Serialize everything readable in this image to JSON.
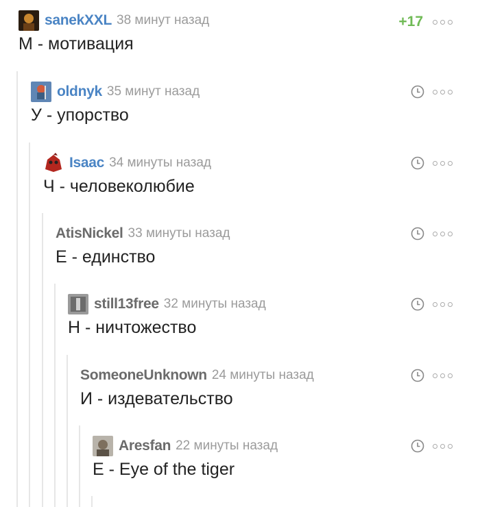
{
  "comments": [
    {
      "author": "sanekXXL",
      "author_color": "#4a84c4",
      "time": "38 минут назад",
      "text": "М - мотивация",
      "rating": "+17",
      "avatar": "dark-avatar"
    },
    {
      "author": "oldnyk",
      "author_color": "#4a84c4",
      "time": "35 минут назад",
      "text": "У - упорство",
      "avatar": "knight-avatar"
    },
    {
      "author": "Isaac",
      "author_color": "#4a84c4",
      "time": "34 минуты назад",
      "text": "Ч - человеколюбие",
      "avatar": "red-creature-avatar"
    },
    {
      "author": "AtisNickel",
      "author_color": "#6b6b6b",
      "time": "33 минуты назад",
      "text": "Е - единство"
    },
    {
      "author": "still13free",
      "author_color": "#6b6b6b",
      "time": "32 минуты назад",
      "text": "Н - ничтожество",
      "avatar": "gray-avatar"
    },
    {
      "author": "SomeoneUnknown",
      "author_color": "#6b6b6b",
      "time": "24 минуты назад",
      "text": "И - издевательство"
    },
    {
      "author": "Aresfan",
      "author_color": "#6b6b6b",
      "time": "22 минуты назад",
      "text": "Е - Eye of the tiger",
      "avatar": "photo-avatar"
    }
  ]
}
